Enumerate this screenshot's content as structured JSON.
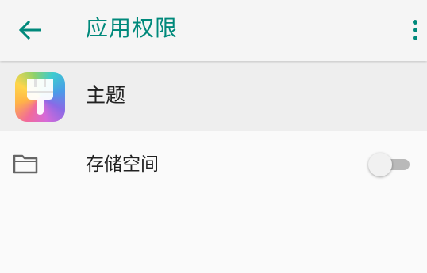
{
  "header": {
    "title": "应用权限",
    "back_icon": "arrow-back-icon",
    "more_icon": "more-vert-icon"
  },
  "app": {
    "name": "主题",
    "icon": "paintbrush-theme-icon"
  },
  "permissions": [
    {
      "label": "存储空间",
      "icon": "folder-icon",
      "enabled": false
    }
  ],
  "colors": {
    "accent": "#00897b",
    "switch_off_track": "#b9b9b9",
    "switch_off_thumb": "#f1f1f1"
  }
}
